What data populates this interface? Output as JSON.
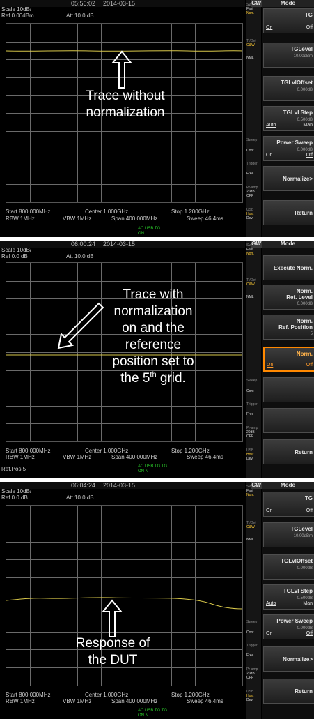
{
  "screens": [
    {
      "time": "05:56:02",
      "date": "2014-03-15",
      "scale": "Scale 10dB/",
      "ref": "Ref 0.00dBm",
      "att": "Att 10.0 dB",
      "start": "Start 800.000MHz",
      "center": "Center 1.000GHz",
      "stop": "Stop 1.200GHz",
      "rbw": "RBW 1MHz",
      "vbw": "VBW 1MHz",
      "span": "Span 400.000MHz",
      "sweep": "Sweep 46.4ms",
      "status": "AC USB TG",
      "status2": "ON",
      "menu_title": "Mode",
      "buttons": [
        {
          "title": "TG",
          "left": "On",
          "right": "Off"
        },
        {
          "title": "TGLevel",
          "sub": "- 10.00dBm"
        },
        {
          "title": "TGLvlOffset",
          "sub": "0.000dB"
        },
        {
          "title": "TGLvl Step",
          "sub": "0.500dB",
          "left": "Auto",
          "right": "Man"
        },
        {
          "title": "Power Sweep",
          "sub": "0.000dB",
          "left": "On",
          "right": "Off"
        },
        {
          "center": "Normalize>"
        },
        {
          "center": "Return"
        }
      ],
      "annotation": [
        "Trace without",
        "normalization"
      ]
    },
    {
      "time": "06:00:24",
      "date": "2014-03-15",
      "scale": "Scale 10dB/",
      "ref": "Ref 0.0 dB",
      "att": "Att 10.0 dB",
      "start": "Start 800.000MHz",
      "center": "Center 1.000GHz",
      "stop": "Stop 1.200GHz",
      "rbw": "RBW 1MHz",
      "vbw": "VBW 1MHz",
      "span": "Span 400.000MHz",
      "sweep": "Sweep 46.4ms",
      "refpos": "Ref.Pos:5",
      "status": "AC USB TG TG",
      "status2": "ON N",
      "menu_title": "Mode",
      "buttons": [
        {
          "center": "Execute Norm."
        },
        {
          "title": "Norm.",
          "title2": "Ref. Level",
          "sub": "0.000dB"
        },
        {
          "title": "Norm.",
          "title2": "Ref. Position",
          "sub": "5"
        },
        {
          "title": "Norm.",
          "left": "On",
          "right": "Off"
        },
        {},
        {},
        {
          "center": "Return"
        }
      ],
      "annotation": [
        "Trace with",
        "normalization",
        "on and the",
        "reference",
        "position set to"
      ],
      "annotation_last": {
        "prefix": "the 5",
        "sup": "th",
        "suffix": " grid."
      }
    },
    {
      "time": "06:04:24",
      "date": "2014-03-15",
      "scale": "Scale 10dB/",
      "ref": "Ref 0.0 dB",
      "att": "Att 10.0 dB",
      "start": "Start 800.000MHz",
      "center": "Center 1.000GHz",
      "stop": "Stop 1.200GHz",
      "rbw": "RBW 1MHz",
      "vbw": "VBW 1MHz",
      "span": "Span 400.000MHz",
      "sweep": "Sweep 46.4ms",
      "status": "AC USB TG TG",
      "status2": "ON N",
      "menu_title": "Mode",
      "buttons": [
        {
          "title": "TG",
          "left": "On",
          "right": "Off"
        },
        {
          "title": "TGLevel",
          "sub": "- 10.00dBm"
        },
        {
          "title": "TGLvlOffset",
          "sub": "0.000dB"
        },
        {
          "title": "TGLvl Step",
          "sub": "0.500dB",
          "left": "Auto",
          "right": "Man"
        },
        {
          "title": "Power Sweep",
          "sub": "0.000dB",
          "left": "On",
          "right": "Off"
        },
        {
          "center": "Normalize>"
        },
        {
          "center": "Return"
        }
      ],
      "annotation": [
        "Response of",
        "the DUT"
      ]
    }
  ],
  "left_panel": {
    "sweep": "Sweep",
    "fast": "Fast",
    "norm": "Norr.",
    "trdet": "Tr/Det",
    "clrw": "C&W",
    "nml": "NML",
    "trigger": "Trigger",
    "free": "Free",
    "preamp": "Pr-amp",
    "preamp_val": "20dB",
    "off": "OFF",
    "usb": "USB",
    "host": "Host",
    "dev": "Dev.",
    "cont": "Cont"
  },
  "colors": {
    "trace": "#d9c84a",
    "grid": "#6a6a6a",
    "highlight": "#ff8800",
    "status_green": "#2bd12b"
  },
  "logo": "GW"
}
